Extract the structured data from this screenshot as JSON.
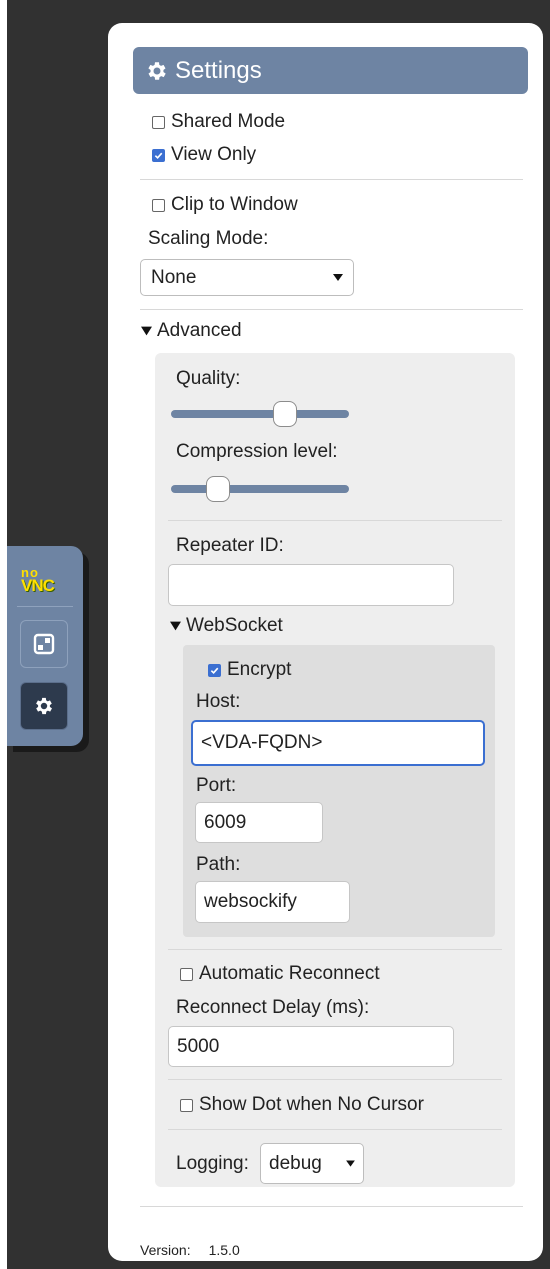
{
  "control_bar": {
    "logo_top": "no",
    "logo_bottom": "VNC"
  },
  "settings": {
    "title": "Settings",
    "shared_mode": {
      "label": "Shared Mode",
      "checked": false
    },
    "view_only": {
      "label": "View Only",
      "checked": true
    },
    "clip_to_window": {
      "label": "Clip to Window",
      "checked": false
    },
    "scaling_mode": {
      "label": "Scaling Mode:",
      "value": "None"
    },
    "advanced": {
      "label": "Advanced",
      "quality": {
        "label": "Quality:",
        "level": 0.62
      },
      "compression": {
        "label": "Compression level:",
        "level": 0.25
      },
      "repeater_id": {
        "label": "Repeater ID:",
        "value": ""
      },
      "websocket": {
        "label": "WebSocket",
        "encrypt": {
          "label": "Encrypt",
          "checked": true
        },
        "host": {
          "label": "Host:",
          "value": "<VDA-FQDN>"
        },
        "port": {
          "label": "Port:",
          "value": "6009"
        },
        "path": {
          "label": "Path:",
          "value": "websockify"
        }
      },
      "auto_reconnect": {
        "label": "Automatic Reconnect",
        "checked": false
      },
      "reconnect_delay": {
        "label": "Reconnect Delay (ms):",
        "value": "5000"
      },
      "show_dot": {
        "label": "Show Dot when No Cursor",
        "checked": false
      },
      "logging": {
        "label": "Logging:",
        "value": "debug"
      }
    },
    "version": {
      "label": "Version:",
      "value": "1.5.0"
    }
  },
  "colors": {
    "accent": "#6e84a3",
    "dark_bg": "#313131",
    "checkbox_checked": "#3b6fd1"
  },
  "icons": {
    "header": "gear-icon",
    "fullscreen": "fullscreen-icon",
    "settings_button": "gear-icon"
  }
}
